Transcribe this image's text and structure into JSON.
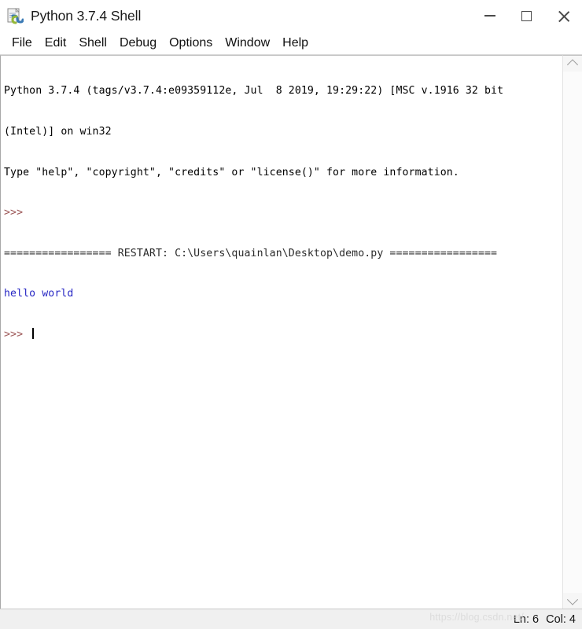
{
  "window": {
    "title": "Python 3.7.4 Shell",
    "icon": "idle-python-icon",
    "controls": {
      "minimize_label": "Minimize",
      "maximize_label": "Maximize",
      "close_label": "Close"
    }
  },
  "menubar": {
    "items": [
      {
        "label": "File"
      },
      {
        "label": "Edit"
      },
      {
        "label": "Shell"
      },
      {
        "label": "Debug"
      },
      {
        "label": "Options"
      },
      {
        "label": "Window"
      },
      {
        "label": "Help"
      }
    ]
  },
  "console": {
    "lines": [
      {
        "id": "banner-line-1",
        "color": "black",
        "text": "Python 3.7.4 (tags/v3.7.4:e09359112e, Jul  8 2019, 19:29:22) [MSC v.1916 32 bit"
      },
      {
        "id": "banner-line-2",
        "color": "black",
        "text": "(Intel)] on win32"
      },
      {
        "id": "banner-line-3",
        "color": "black",
        "text": "Type \"help\", \"copyright\", \"credits\" or \"license()\" for more information."
      },
      {
        "id": "prompt-line-1",
        "color": "prompt",
        "text": ">>> "
      },
      {
        "id": "restart-line",
        "color": "restart",
        "text": "================= RESTART: C:\\Users\\quainlan\\Desktop\\demo.py ================="
      },
      {
        "id": "program-output",
        "color": "output",
        "text": "hello world"
      }
    ],
    "active_prompt": {
      "id": "prompt-line-2",
      "color": "prompt",
      "text": ">>> ",
      "cursor_visible": true
    }
  },
  "scrollbar": {
    "up_arrow": "chevron-up-icon",
    "down_arrow": "chevron-down-icon"
  },
  "statusbar": {
    "line_label": "Ln: 6",
    "col_label": "Col: 4",
    "watermark": "https://blog.csdn.net/"
  },
  "colors": {
    "output_blue": "#2727c4",
    "prompt_red": "#9b5454",
    "text_black": "#000000",
    "chrome_gray": "#f0f0f0"
  }
}
